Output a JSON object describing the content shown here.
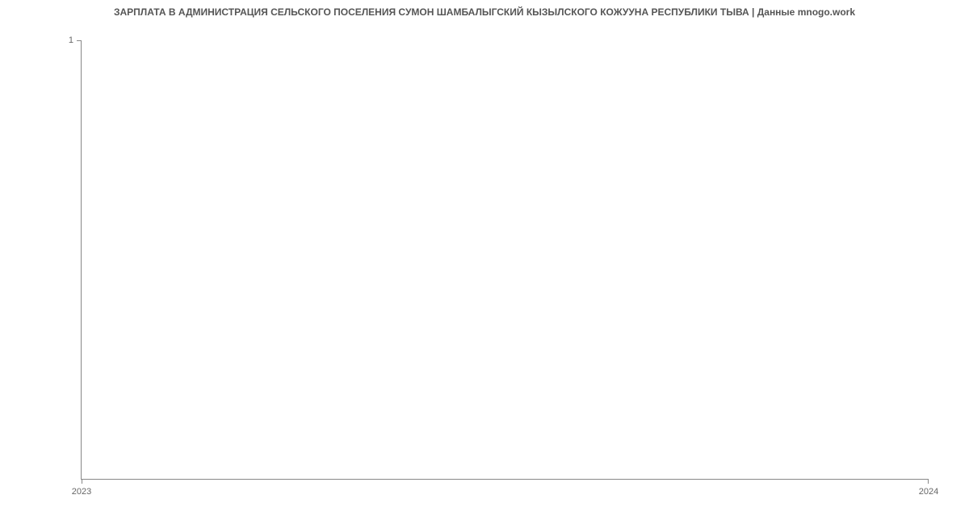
{
  "chart_data": {
    "type": "line",
    "title": "ЗАРПЛАТА В АДМИНИСТРАЦИЯ СЕЛЬСКОГО ПОСЕЛЕНИЯ СУМОН ШАМБАЛЫГСКИЙ КЫЗЫЛСКОГО КОЖУУНА РЕСПУБЛИКИ ТЫВА | Данные mnogo.work",
    "x_ticks": [
      "2023",
      "2024"
    ],
    "y_ticks": [
      "1"
    ],
    "xlabel": "",
    "ylabel": "",
    "xlim": [
      2023,
      2024
    ],
    "ylim": [
      0,
      1
    ],
    "series": []
  }
}
